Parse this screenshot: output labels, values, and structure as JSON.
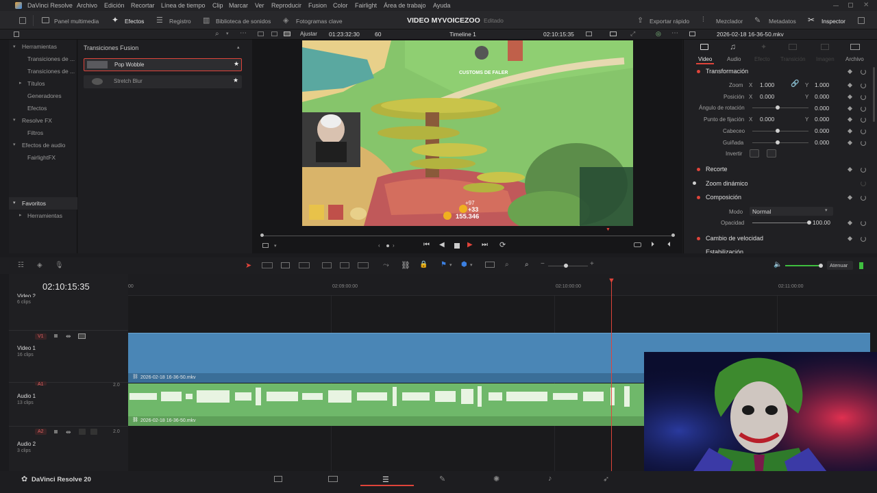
{
  "menu": {
    "app": "DaVinci Resolve",
    "items": [
      "Archivo",
      "Edición",
      "Recortar",
      "Línea de tiempo",
      "Clip",
      "Marcar",
      "Ver",
      "Reproducir",
      "Fusion",
      "Color",
      "Fairlight",
      "Área de trabajo",
      "Ayuda"
    ]
  },
  "toolbar": {
    "panel_multimedia": "Panel multimedia",
    "efectos": "Efectos",
    "registro": "Registro",
    "biblioteca": "Biblioteca de sonidos",
    "fotogramas": "Fotogramas clave",
    "project_title": "VIDEO MYVOICEZOO",
    "project_status": "Editado",
    "exportar": "Exportar rápido",
    "mezclador": "Mezclador",
    "metadatos": "Metadatos",
    "inspector": "Inspector"
  },
  "viewerbar": {
    "zoom": "Ajustar",
    "source_tc": "01:23:32:30",
    "fps": "60",
    "timeline_name": "Timeline 1",
    "timeline_tc": "02:10:15:35",
    "clip_name": "2026-02-18 16-36-50.mkv"
  },
  "left_panel": {
    "herramientas": "Herramientas",
    "items": [
      "Transiciones de ...",
      "Transiciones de ...",
      "Títulos",
      "Generadores",
      "Efectos"
    ],
    "resolve_fx": "Resolve FX",
    "filtros": "Filtros",
    "efectos_audio": "Efectos de audio",
    "fairlightfx": "FairlightFX",
    "favoritos": "Favoritos",
    "fav_herramientas": "Herramientas"
  },
  "effects": {
    "section": "Transiciones Fusion",
    "items": [
      "Pop Wobble",
      "Stretch Blur"
    ]
  },
  "inspector": {
    "tabs": [
      "Video",
      "Audio",
      "Efecto",
      "Transición",
      "Imagen",
      "Archivo"
    ],
    "transformacion": "Transformación",
    "zoom_label": "Zoom",
    "zoom_x": "1.000",
    "zoom_y": "1.000",
    "posicion_label": "Posición",
    "pos_x": "0.000",
    "pos_y": "0.000",
    "angulo_label": "Ángulo de rotación",
    "angulo": "0.000",
    "punto_label": "Punto de fijación",
    "punto_x": "0.000",
    "punto_y": "0.000",
    "cabeceo_label": "Cabeceo",
    "cabeceo": "0.000",
    "guinada_label": "Guiñada",
    "guinada": "0.000",
    "invertir_label": "Invertir",
    "recorte": "Recorte",
    "zoom_dinamico": "Zoom dinámico",
    "composicion": "Composición",
    "modo_label": "Modo",
    "modo": "Normal",
    "opacidad_label": "Opacidad",
    "opacidad": "100.00",
    "cambio_velocidad": "Cambio de velocidad",
    "estabilizacion": "Estabilización",
    "x": "X",
    "y": "Y"
  },
  "video_overlay": {
    "customs": "CUSTOMS DE FALER",
    "score_plus": "+33",
    "score_plus2": "+97",
    "score": "155.346"
  },
  "timeline": {
    "timecode": "02:10:15:35",
    "atenuar": "Atenuar",
    "ruler": [
      "00",
      "02:09:00:00",
      "02:10:00:00",
      "02:11:00:00"
    ],
    "tracks": [
      {
        "id": "",
        "name": "Video 2",
        "clips": "6 clips"
      },
      {
        "id": "V1",
        "name": "Video 1",
        "clips": "16 clips"
      },
      {
        "id": "A1",
        "name": "Audio 1",
        "clips": "13 clips"
      },
      {
        "id": "A2",
        "name": "Audio 2",
        "clips": "3 clips"
      }
    ],
    "a1_level": "2.0",
    "a2_level": "2.0",
    "video_clip": "2026-02-18 16-36-50.mkv",
    "audio_clip": "2026-02-18 16-36-50.mkv"
  },
  "pagebar": {
    "brand": "DaVinci Resolve 20"
  },
  "colors": {
    "accent_red": "#e0443a",
    "video_clip": "#4a86b6",
    "audio_clip": "#6fb86a"
  }
}
